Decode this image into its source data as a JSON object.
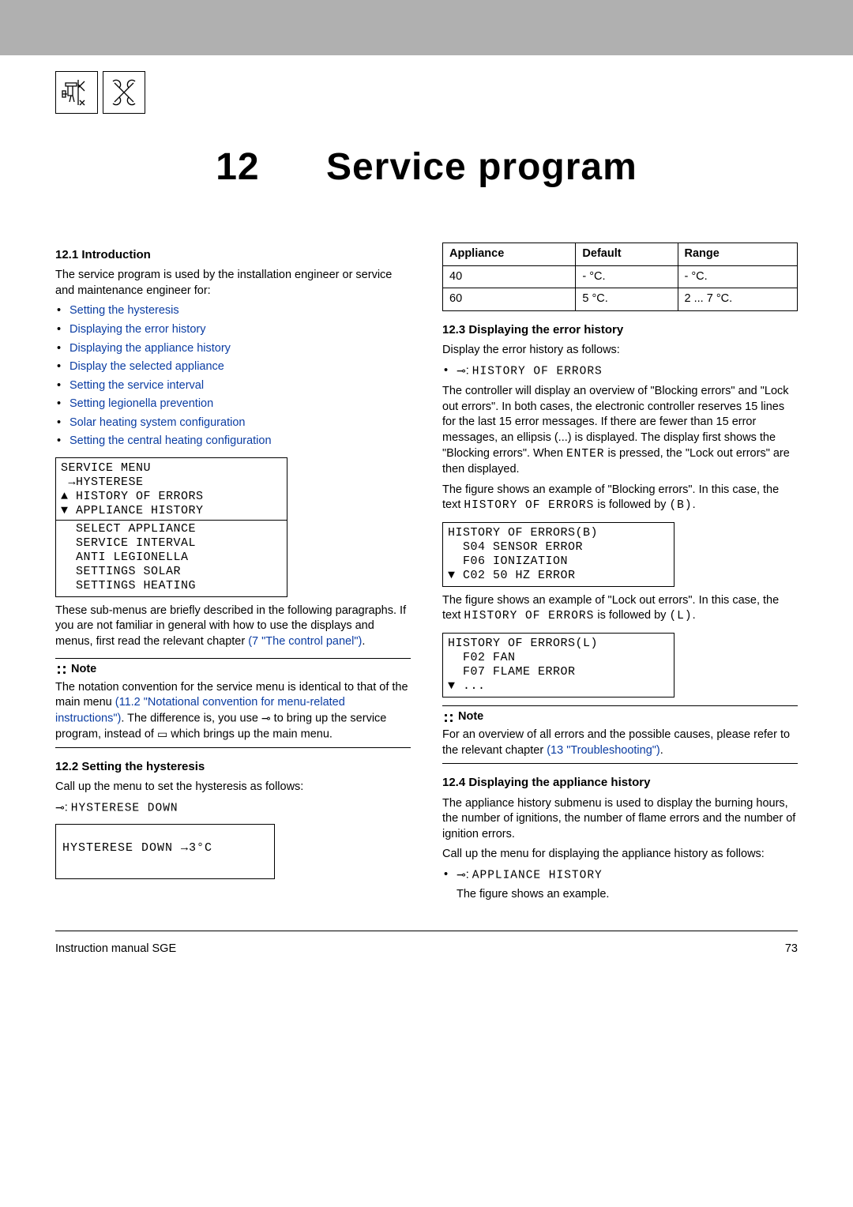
{
  "chapter": {
    "number": "12",
    "title": "Service program"
  },
  "s12_1": {
    "heading": "12.1  Introduction",
    "p1": "The service program is used by the installation engineer or service and maintenance engineer for:",
    "links": [
      "Setting the hysteresis",
      "Displaying the error history",
      "Displaying the appliance history",
      "Display the selected appliance",
      "Setting the service interval",
      "Setting legionella prevention",
      "Solar heating system configuration",
      "Setting the central heating configuration"
    ],
    "lcd_top": "SERVICE MENU\n →HYSTERESE\n▲ HISTORY OF ERRORS\n▼ APPLIANCE HISTORY",
    "lcd_bottom": "  SELECT APPLIANCE\n  SERVICE INTERVAL\n  ANTI LEGIONELLA\n  SETTINGS SOLAR\n  SETTINGS HEATING",
    "p2a": "These sub-menus are briefly described in the following paragraphs. If you are not familiar in general with how to use the displays and menus, first read the relevant chapter ",
    "p2link": "(7 \"The control panel\")",
    "p2b": ".",
    "note_head": "Note",
    "note_a": "The notation convention for the service menu is identical to that of the main menu ",
    "note_link": "(11.2 \"Notational convention for menu-related instructions\")",
    "note_b": ". The difference is, you use ",
    "note_c": " to bring up the service program, instead of ",
    "note_d": " which brings up the main menu."
  },
  "s12_2": {
    "heading": "12.2  Setting the hysteresis",
    "p1": "Call up the menu to set the hysteresis as follows:",
    "cmd": "HYSTERESE DOWN",
    "lcd": "HYSTERESE DOWN  →3°C"
  },
  "table": {
    "h1": "Appliance",
    "h2": "Default",
    "h3": "Range",
    "r1c1": "40",
    "r1c2": "- °C.",
    "r1c3": "- °C.",
    "r2c1": "60",
    "r2c2": "5 °C.",
    "r2c3": "2 ... 7 °C."
  },
  "s12_3": {
    "heading": "12.3  Displaying the error history",
    "p1": "Display the error history as follows:",
    "cmd": "HISTORY OF ERRORS",
    "p2a": "The controller will display an overview of \"Blocking errors\" and \"Lock out errors\". In both cases, the electronic controller reserves 15 lines for the last 15 error messages. If there are fewer than 15 error messages, an ellipsis (...) is displayed. The display first shows the \"Blocking errors\". When ",
    "enter": "ENTER",
    "p2b": " is pressed, the \"Lock out errors\" are then displayed.",
    "p3a": "The figure shows an example of \"Blocking errors\". In this case, the text ",
    "p3code": "HISTORY OF ERRORS",
    "p3b": " is followed by ",
    "p3code2": "(B)",
    "p3c": ".",
    "lcdB": "HISTORY OF ERRORS(B)\n  S04 SENSOR ERROR\n  F06 IONIZATION\n▼ C02 50 HZ ERROR",
    "p4a": "The figure shows an example of \"Lock out errors\". In this case, the text ",
    "p4code": "HISTORY OF ERRORS",
    "p4b": " is followed by ",
    "p4code2": "(L)",
    "p4c": ".",
    "lcdL": "HISTORY OF ERRORS(L)\n  F02 FAN\n  F07 FLAME ERROR\n▼ ...",
    "note_head": "Note",
    "note_body_a": "For an overview of all errors and the possible causes, please refer to the relevant chapter ",
    "note_link": "(13 \"Troubleshooting\")",
    "note_body_b": "."
  },
  "s12_4": {
    "heading": "12.4  Displaying the appliance history",
    "p1": "The appliance history submenu is used to display the burning hours, the number of ignitions, the number of flame errors and the number of ignition errors.",
    "p2": "Call up the menu for displaying the appliance history as follows:",
    "cmd": "APPLIANCE HISTORY",
    "p3": "The figure shows an example."
  },
  "footer": {
    "left": "Instruction manual SGE",
    "right": "73"
  }
}
